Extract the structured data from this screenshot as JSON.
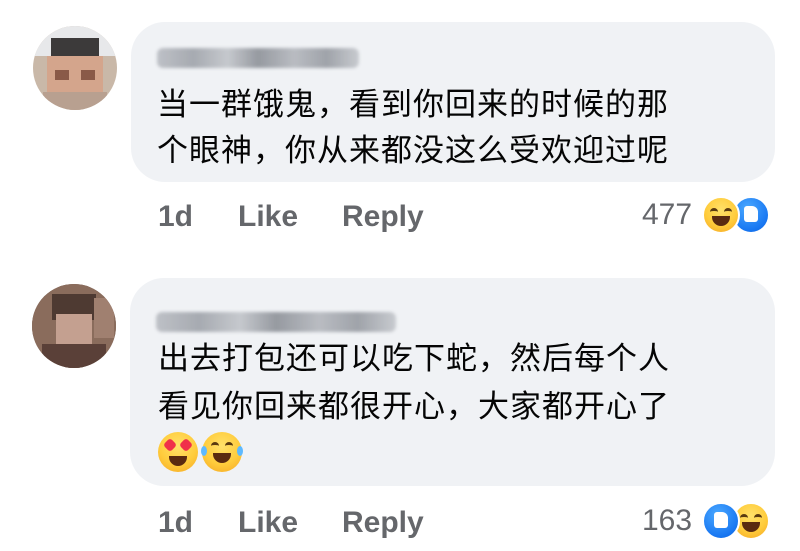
{
  "comments": [
    {
      "text_line1": "当一群饿鬼，看到你回来的时候的那",
      "text_line2": "个眼神，你从来都没这么受欢迎过呢",
      "time": "1d",
      "like_label": "Like",
      "reply_label": "Reply",
      "reaction_count": "477",
      "reactions": [
        "haha-icon",
        "like-icon"
      ]
    },
    {
      "text_line1": "出去打包还可以吃下蛇，然后每个人",
      "text_line2": "看见你回来都很开心，大家都开心了",
      "inline_emojis": [
        "heart-eyes-emoji",
        "tears-of-joy-emoji"
      ],
      "time": "1d",
      "like_label": "Like",
      "reply_label": "Reply",
      "reaction_count": "163",
      "reactions": [
        "like-icon",
        "haha-icon"
      ]
    }
  ],
  "colors": {
    "bubble": "#f0f2f5",
    "meta_text": "#65676b",
    "body_text": "#050505",
    "like_blue": "#1877f2",
    "haha_yellow": "#ffcc3c"
  }
}
